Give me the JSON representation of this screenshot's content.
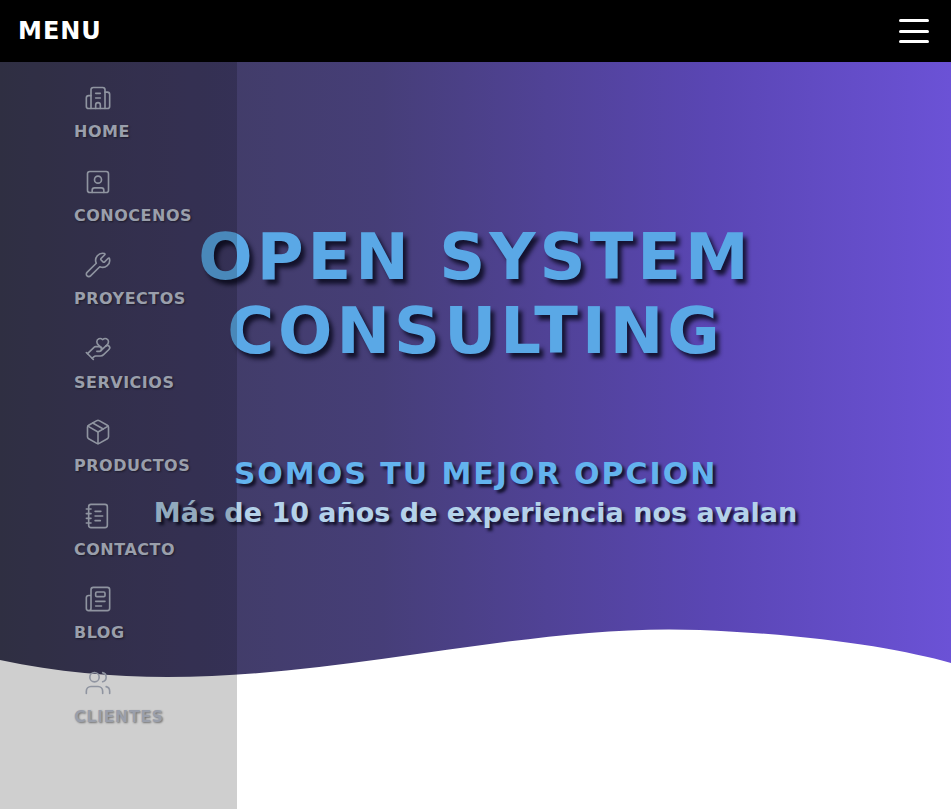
{
  "header": {
    "title": "MENU"
  },
  "hero": {
    "title_lines": [
      "OPEN SYSTEM",
      "CONSULTING"
    ],
    "tagline": "SOMOS TU MEJOR OPCION",
    "subtitle": "Más de 10 años de experiencia nos avalan"
  },
  "sidebar": {
    "items": [
      {
        "label": "HOME"
      },
      {
        "label": "CONOCENOS"
      },
      {
        "label": "PROYECTOS"
      },
      {
        "label": "SERVICIOS"
      },
      {
        "label": "PRODUCTOS"
      },
      {
        "label": "CONTACTO"
      },
      {
        "label": "BLOG"
      },
      {
        "label": "CLIENTES"
      }
    ]
  }
}
